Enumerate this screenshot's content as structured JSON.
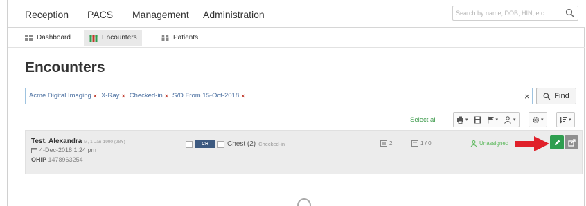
{
  "topnav": {
    "items": [
      "Reception",
      "PACS",
      "Management",
      "Administration"
    ],
    "search_placeholder": "Search by name, DOB, HIN, etc."
  },
  "subnav": {
    "tabs": [
      {
        "label": "Dashboard",
        "icon": "dashboard-icon",
        "active": false
      },
      {
        "label": "Encounters",
        "icon": "encounters-icon",
        "active": true
      },
      {
        "label": "Patients",
        "icon": "patients-icon",
        "active": false
      }
    ]
  },
  "page": {
    "title": "Encounters"
  },
  "filters": {
    "chips": [
      "Acme Digital Imaging",
      "X-Ray",
      "Checked-in",
      "S/D From 15-Oct-2018"
    ],
    "clear_label": "×",
    "find_label": "Find"
  },
  "toolbar": {
    "select_all": "Select all"
  },
  "encounter": {
    "name": "Test, Alexandra",
    "meta": "M, 1-Jan-1990 (28Y)",
    "datetime": "4-Dec-2018 1:24 pm",
    "hin_label": "OHIP",
    "hin": "1478963254",
    "modality": "CR",
    "procedure": "Chest (2)",
    "procedure_status": "Checked-in",
    "image_count": "2",
    "report_count": "1 / 0",
    "assign_status": "Unassigned"
  },
  "colors": {
    "accent_green": "#2e9e4f",
    "arrow_red": "#e0202a",
    "chip_text": "#4a6fa0",
    "chip_x": "#c0392b"
  }
}
